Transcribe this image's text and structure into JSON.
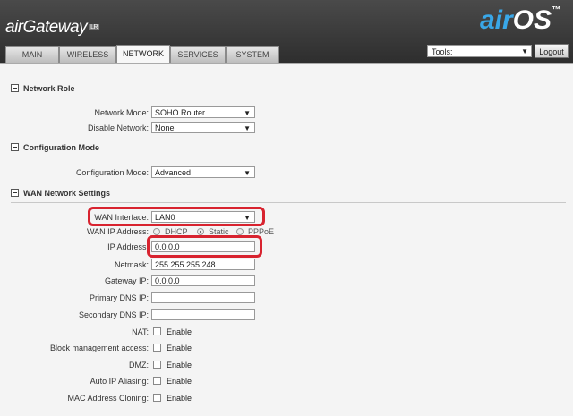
{
  "header": {
    "brand": "airGateway",
    "brand_badge": "LR",
    "logo_air": "air",
    "logo_os": "OS",
    "logo_tm": "™"
  },
  "tabs": [
    {
      "label": "MAIN"
    },
    {
      "label": "WIRELESS"
    },
    {
      "label": "NETWORK",
      "active": true
    },
    {
      "label": "SERVICES"
    },
    {
      "label": "SYSTEM"
    }
  ],
  "tools": {
    "label": "Tools:",
    "logout": "Logout"
  },
  "network_role": {
    "title": "Network Role",
    "network_mode_label": "Network Mode:",
    "network_mode_value": "SOHO Router",
    "disable_network_label": "Disable Network:",
    "disable_network_value": "None"
  },
  "configuration_mode": {
    "title": "Configuration Mode",
    "label": "Configuration Mode:",
    "value": "Advanced"
  },
  "wan": {
    "title": "WAN Network Settings",
    "interface_label": "WAN Interface:",
    "interface_value": "LAN0",
    "ip_address_mode_label": "WAN IP Address:",
    "mode_options": [
      "DHCP",
      "Static",
      "PPPoE"
    ],
    "selected_mode": "Static",
    "ip_label": "IP Address:",
    "ip_value": "0.0.0.0",
    "netmask_label": "Netmask:",
    "netmask_value": "255.255.255.248",
    "gateway_label": "Gateway IP:",
    "gateway_value": "0.0.0.0",
    "primary_dns_label": "Primary DNS IP:",
    "primary_dns_value": "",
    "secondary_dns_label": "Secondary DNS IP:",
    "secondary_dns_value": "",
    "nat_label": "NAT:",
    "block_mgmt_label": "Block management access:",
    "dmz_label": "DMZ:",
    "auto_ip_label": "Auto IP Aliasing:",
    "mac_clone_label": "MAC Address Cloning:",
    "enable_text": "Enable"
  },
  "colors": {
    "highlight": "#d8232f",
    "logo_blue": "#39a7e8"
  }
}
